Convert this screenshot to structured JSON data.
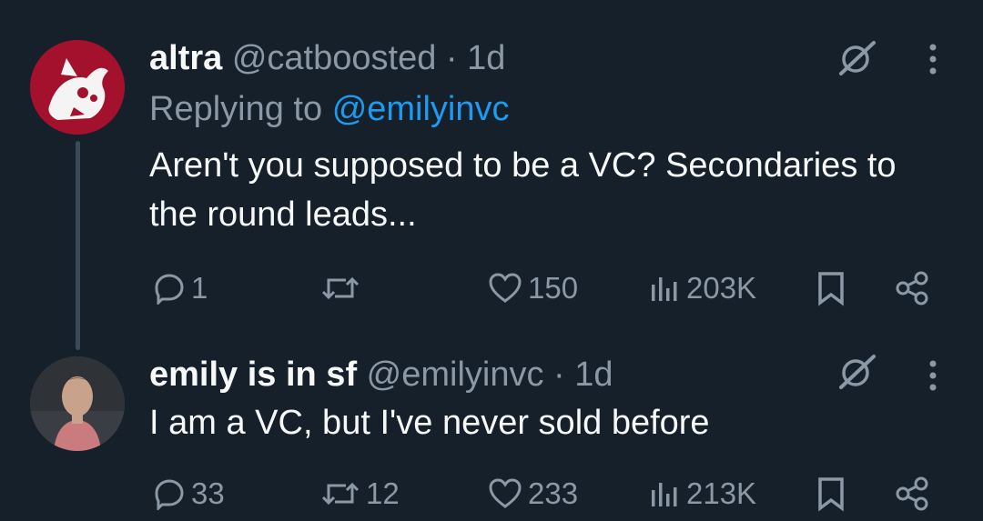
{
  "posts": [
    {
      "display_name": "altra",
      "handle": "@catboosted",
      "time": "1d",
      "replying_prefix": "Replying to",
      "replying_to": "@emilyinvc",
      "text": "Aren't you supposed to be a VC? Secondaries to the round leads...",
      "replies": "1",
      "reposts": "",
      "likes": "150",
      "views": "203K",
      "avatar_color": "#a3112c"
    },
    {
      "display_name": "emily is in sf",
      "handle": "@emilyinvc",
      "time": "1d",
      "text": "I am a VC, but I've never sold before",
      "replies": "33",
      "reposts": "12",
      "likes": "233",
      "views": "213K",
      "avatar_color": "#3b3f45"
    }
  ],
  "separator": "·",
  "colors": {
    "background": "#15202b",
    "text_primary": "#f7f9f9",
    "text_secondary": "#8b98a5",
    "link": "#1d9bf0"
  },
  "icons": [
    "reply-icon",
    "repost-icon",
    "like-icon",
    "views-icon",
    "bookmark-icon",
    "share-icon",
    "grok-icon",
    "more-icon"
  ]
}
